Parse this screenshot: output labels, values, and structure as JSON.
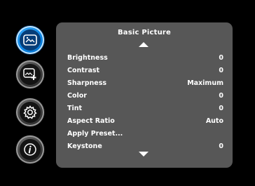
{
  "sidebar": {
    "items": [
      {
        "icon": "picture-icon",
        "active": true
      },
      {
        "icon": "advanced-picture-icon",
        "active": false
      },
      {
        "icon": "settings-gear-icon",
        "active": false
      },
      {
        "icon": "info-icon",
        "active": false
      }
    ]
  },
  "menu": {
    "title": "Basic Picture",
    "rows": [
      {
        "label": "Brightness",
        "value": "0"
      },
      {
        "label": "Contrast",
        "value": "0"
      },
      {
        "label": "Sharpness",
        "value": "Maximum"
      },
      {
        "label": "Color",
        "value": "0"
      },
      {
        "label": "Tint",
        "value": "0"
      },
      {
        "label": "Aspect Ratio",
        "value": "Auto"
      },
      {
        "label": "Apply Preset...",
        "value": ""
      },
      {
        "label": "Keystone",
        "value": "0"
      }
    ]
  },
  "colors": {
    "background": "#000000",
    "panel": "#575757",
    "active_icon": "#0a84e4",
    "text": "#ffffff"
  }
}
